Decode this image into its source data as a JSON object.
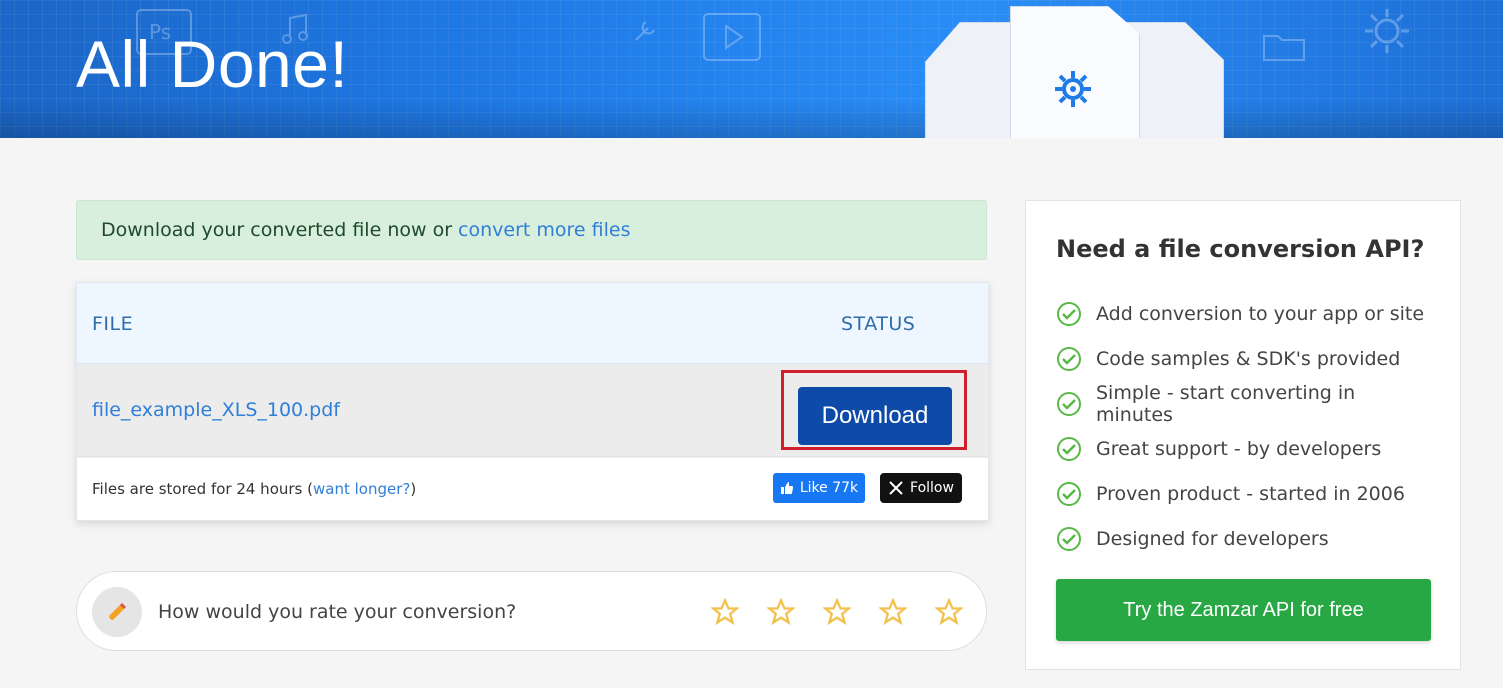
{
  "hero": {
    "title": "All Done!",
    "background_color": "#1f7be8",
    "icons": [
      "photoshop-icon",
      "music-note-icon",
      "play-icon",
      "wrench-icon",
      "folder-icon",
      "gear-icon"
    ]
  },
  "alert": {
    "prefix": "Download your converted file now or ",
    "link": "convert more files",
    "background_color": "#d8efdd",
    "link_color": "#2f7ed8"
  },
  "files": {
    "headers": {
      "file": "FILE",
      "status": "STATUS"
    },
    "rows": [
      {
        "name": "file_example_XLS_100.pdf",
        "action_label": "Download",
        "highlight_color": "#cf1f2f",
        "button_color": "#0e4ba8"
      }
    ],
    "storage_prefix": "Files are stored for 24 hours (",
    "storage_link": "want longer?",
    "storage_suffix": ")",
    "social": {
      "like_label": "Like 77k",
      "follow_label": "Follow"
    }
  },
  "rating": {
    "label": "How would you rate your conversion?",
    "icon": "pencil-icon",
    "star_count": 5,
    "star_color": "#f2c14e"
  },
  "api_sidebar": {
    "title": "Need a file conversion API?",
    "items": [
      "Add conversion to your app or site",
      "Code samples & SDK's provided",
      "Simple - start converting in minutes",
      "Great support - by developers",
      "Proven product - started in 2006",
      "Designed for developers"
    ],
    "button_label": "Try the Zamzar API for free",
    "button_color": "#28a745",
    "check_color": "#58b846"
  }
}
